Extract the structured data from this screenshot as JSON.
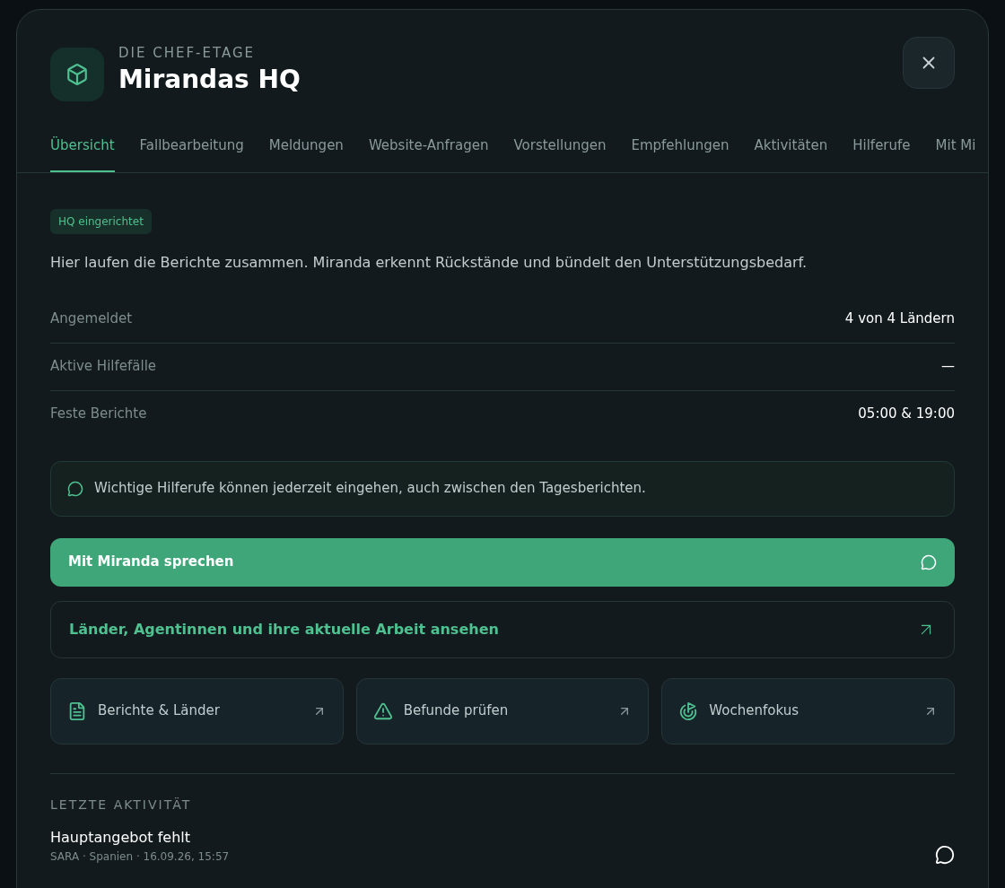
{
  "header": {
    "eyebrow": "DIE CHEF-ETAGE",
    "title": "Mirandas HQ"
  },
  "tabs": [
    {
      "label": "Übersicht",
      "selected": true
    },
    {
      "label": "Fallbearbeitung",
      "selected": false
    },
    {
      "label": "Meldungen",
      "selected": false
    },
    {
      "label": "Website-Anfragen",
      "selected": false
    },
    {
      "label": "Vorstellungen",
      "selected": false
    },
    {
      "label": "Empfehlungen",
      "selected": false
    },
    {
      "label": "Aktivitäten",
      "selected": false
    },
    {
      "label": "Hilferufe",
      "selected": false
    },
    {
      "label": "Mit Mi",
      "selected": false
    }
  ],
  "badge": "HQ eingerichtet",
  "intro": "Hier laufen die Berichte zusammen. Miranda erkennt Rückstände und bündelt den Unterstützungsbedarf.",
  "stats": [
    {
      "label": "Angemeldet",
      "value": "4 von 4 Ländern"
    },
    {
      "label": "Aktive Hilfefälle",
      "value": "—"
    },
    {
      "label": "Feste Berichte",
      "value": "05:00 & 19:00"
    }
  ],
  "notice": "Wichtige Hilferufe können jederzeit eingehen, auch zwischen den Tagesberichten.",
  "primary_action": "Mit Miranda sprechen",
  "secondary_action": "Länder, Agentinnen und ihre aktuelle Arbeit ansehen",
  "shortcuts": [
    {
      "kind": "document",
      "label": "Berichte & Länder"
    },
    {
      "kind": "warning",
      "label": "Befunde prüfen"
    },
    {
      "kind": "target",
      "label": "Wochenfokus"
    }
  ],
  "activity": {
    "heading": "LETZTE AKTIVITÄT",
    "items": [
      {
        "title": "Hauptangebot fehlt",
        "meta": "SARA · Spanien · 16.09.26, 15:57"
      }
    ]
  }
}
